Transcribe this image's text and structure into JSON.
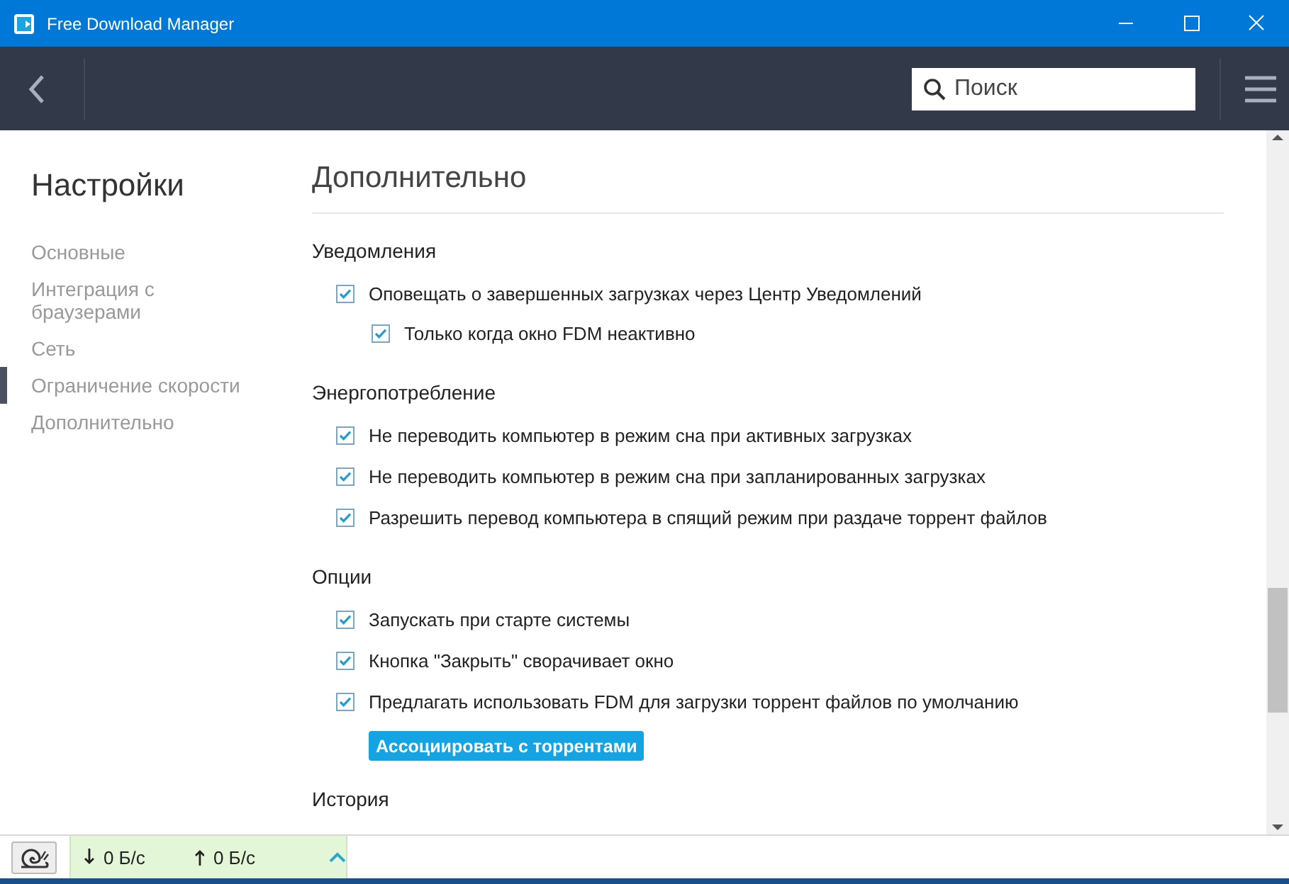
{
  "window": {
    "title": "Free Download Manager"
  },
  "toolbar": {
    "search": {
      "placeholder": "Поиск"
    }
  },
  "sidebar": {
    "title": "Настройки",
    "items": [
      {
        "label": "Основные",
        "selected": false
      },
      {
        "label": "Интеграция с браузерами",
        "selected": false
      },
      {
        "label": "Сеть",
        "selected": false
      },
      {
        "label": "Ограничение скорости",
        "selected": true
      },
      {
        "label": "Дополнительно",
        "selected": false
      }
    ]
  },
  "content": {
    "title": "Дополнительно",
    "sections": [
      {
        "heading": "Уведомления",
        "options": [
          {
            "label": "Оповещать о завершенных загрузках через Центр Уведомлений",
            "checked": true,
            "children": [
              {
                "label": "Только когда окно FDM неактивно",
                "checked": true
              }
            ]
          }
        ]
      },
      {
        "heading": "Энергопотребление",
        "options": [
          {
            "label": "Не переводить компьютер в режим сна при активных загрузках",
            "checked": true
          },
          {
            "label": "Не переводить компьютер в режим сна при запланированных загрузках",
            "checked": true
          },
          {
            "label": "Разрешить перевод компьютера в спящий режим при раздаче торрент файлов",
            "checked": true
          }
        ]
      },
      {
        "heading": "Опции",
        "options": [
          {
            "label": "Запускать при старте системы",
            "checked": true
          },
          {
            "label": "Кнопка \"Закрыть\" сворачивает окно",
            "checked": true
          },
          {
            "label": "Предлагать использовать FDM для загрузки торрент файлов по умолчанию",
            "checked": true
          }
        ],
        "button": "Ассоциировать с торрентами"
      },
      {
        "heading": "История"
      }
    ]
  },
  "status_bar": {
    "download": "0 Б/с",
    "upload": "0 Б/с"
  }
}
